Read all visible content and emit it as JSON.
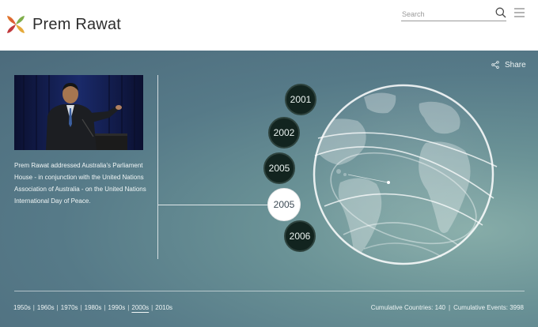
{
  "header": {
    "brand": "Prem Rawat",
    "search_placeholder": "Search"
  },
  "share_label": "Share",
  "event": {
    "description": "Prem Rawat addressed Australia's Parliament House - in conjunction with the United Nations Association of Australia - on the United Nations International Day of Peace."
  },
  "timeline": {
    "years": [
      "2001",
      "2002",
      "2005",
      "2005",
      "2006"
    ],
    "active_index": 3
  },
  "decades": [
    "1950s",
    "1960s",
    "1970s",
    "1980s",
    "1990s",
    "2000s",
    "2010s"
  ],
  "selected_decade": "2000s",
  "stats": {
    "countries": "Cumulative Countries: 140",
    "separator": "|",
    "events": "Cumulative Events: 3998"
  },
  "colors": {
    "panel": "#567a88",
    "year_bubble": "#12241f",
    "active_bubble": "#ffffff",
    "brand_text": "#2e2e2e"
  },
  "icons": [
    "logo-icon",
    "search-icon",
    "menu-icon",
    "share-icon",
    "globe-graphic"
  ]
}
